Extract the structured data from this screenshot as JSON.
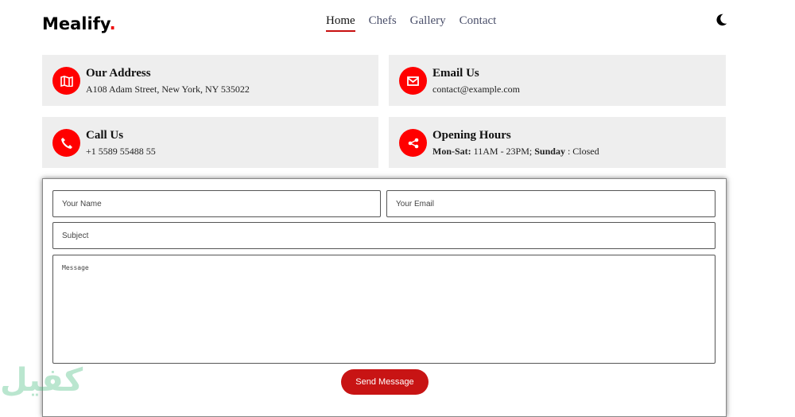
{
  "brand": {
    "name": "Mealify",
    "dot": "."
  },
  "nav": [
    {
      "label": "Home",
      "active": true
    },
    {
      "label": "Chefs"
    },
    {
      "label": "Gallery"
    },
    {
      "label": "Contact"
    }
  ],
  "theme_toggle_icon": "moon-icon",
  "cards": [
    {
      "icon": "map-icon",
      "title": "Our Address",
      "value": "A108 Adam Street, New York, NY 535022"
    },
    {
      "icon": "envelope-icon",
      "title": "Email Us",
      "value": "contact@example.com"
    },
    {
      "icon": "phone-icon",
      "title": "Call Us",
      "value": "+1 5589 55488 55"
    },
    {
      "icon": "share-icon",
      "title": "Opening Hours",
      "days1": "Mon-Sat:",
      "hours1": " 11AM - 23PM; ",
      "days2": "Sunday",
      "hours2": " : Closed"
    }
  ],
  "form": {
    "name_placeholder": "Your Name",
    "email_placeholder": "Your Email",
    "subject_placeholder": "Subject",
    "message_placeholder": "Message",
    "submit": "Send Message"
  },
  "watermark": "كفيل",
  "colors": {
    "accent": "#ff0000",
    "button": "#c81414"
  }
}
